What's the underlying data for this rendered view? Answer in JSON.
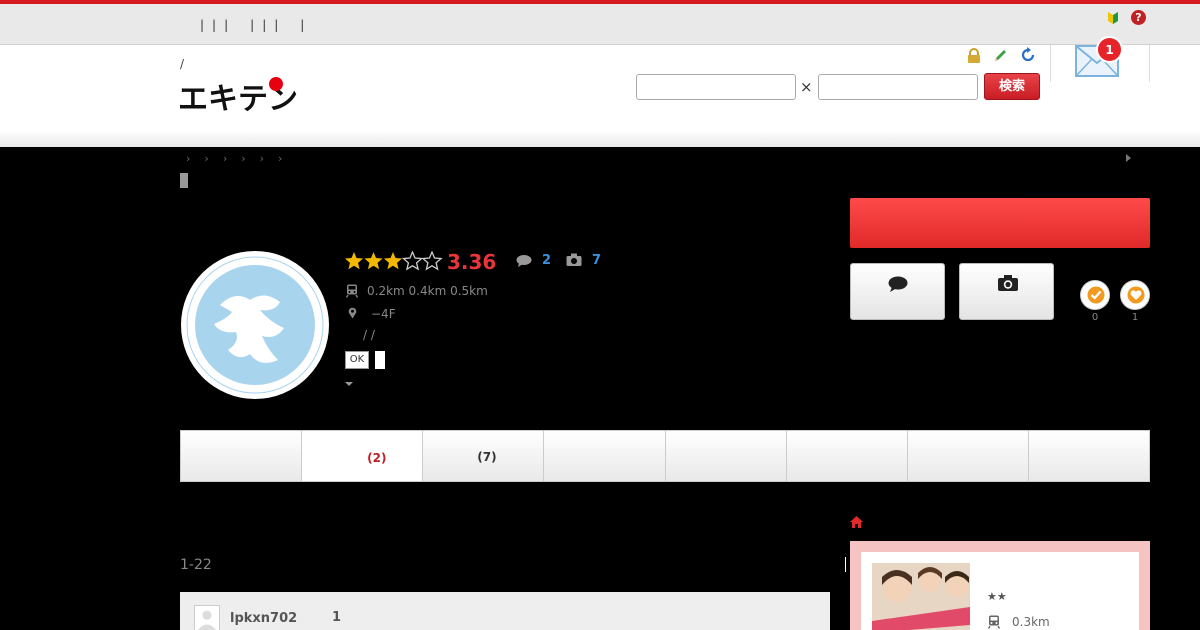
{
  "topbar": {
    "separators": [
      "|",
      "|",
      "|",
      "|",
      "|",
      "|",
      "|"
    ],
    "help_label": "?"
  },
  "header": {
    "slash": "/",
    "logo_text": "エキテン",
    "clear_symbol": "×",
    "search_button": "検索",
    "mail_count": "1"
  },
  "breadcrumb": {
    "chevrons": [
      "›",
      "›",
      "›",
      "›",
      "›",
      "›"
    ]
  },
  "shop": {
    "rating": 3.36,
    "rating_text": "3.36",
    "stars_filled": 3,
    "stars_total": 5,
    "comment_count": "2",
    "photo_count": "7",
    "distances": "0.2km  0.4km  0.5km",
    "floor": "−4F",
    "slashes": "/   /",
    "ok_label": "OK",
    "check_count": "0",
    "like_count": "1"
  },
  "tabs": [
    {
      "label": "",
      "active": false
    },
    {
      "label": "(2)",
      "active": true
    },
    {
      "label": "(7)",
      "active": false
    },
    {
      "label": "",
      "active": false
    },
    {
      "label": "",
      "active": false
    },
    {
      "label": "",
      "active": false
    },
    {
      "label": "",
      "active": false
    },
    {
      "label": "",
      "active": false
    }
  ],
  "reviews": {
    "range": "1-22",
    "first": {
      "user": "lpkxn702",
      "num": "1"
    }
  },
  "sidebar": {
    "shop_card": {
      "stars": "★★",
      "distance": "0.3km"
    }
  },
  "colors": {
    "brand_red": "#d6191f",
    "accent_blue": "#3b8fe0",
    "star_gold": "#f2b800"
  }
}
